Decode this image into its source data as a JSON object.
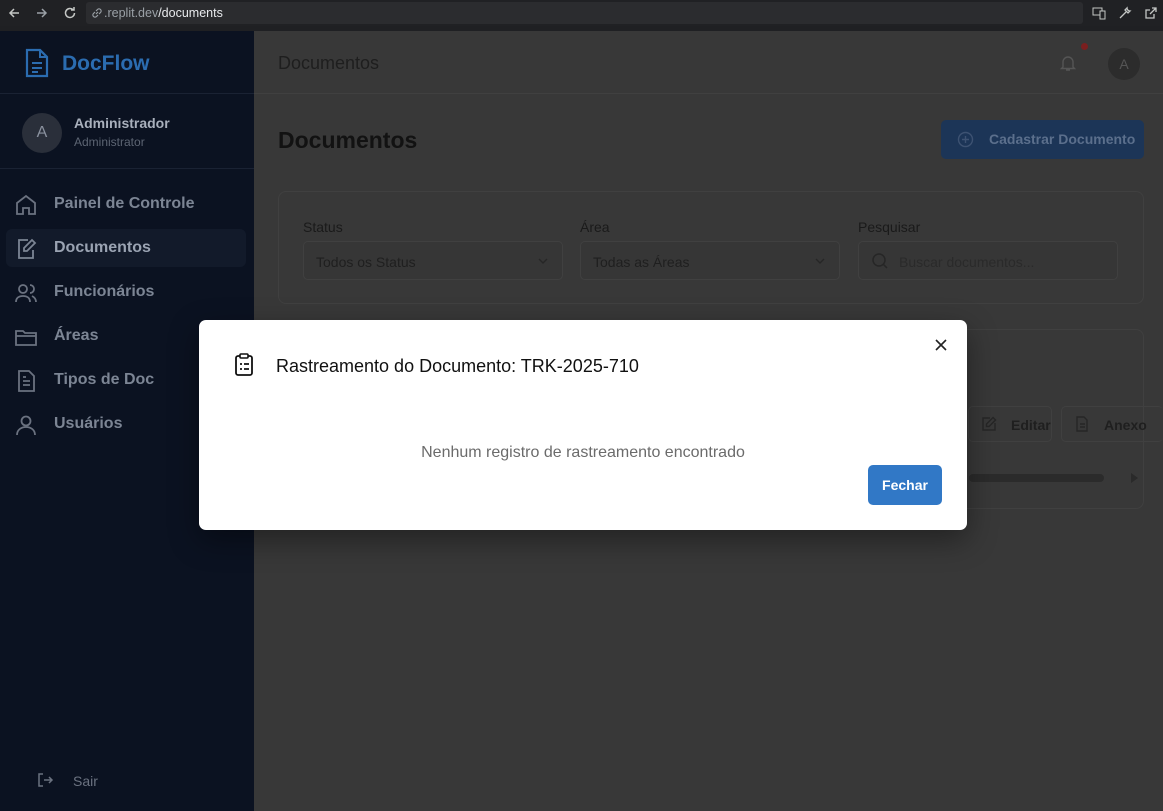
{
  "browser": {
    "url_host": ".replit.dev",
    "url_path": "/documents"
  },
  "sidebar": {
    "brand": "DocFlow",
    "user": {
      "initial": "A",
      "name": "Administrador",
      "role": "Administrator"
    },
    "items": [
      {
        "label": "Painel de Controle",
        "icon": "home-icon",
        "active": false
      },
      {
        "label": "Documentos",
        "icon": "document-edit-icon",
        "active": true
      },
      {
        "label": "Funcionários",
        "icon": "users-icon",
        "active": false
      },
      {
        "label": "Áreas",
        "icon": "folder-icon",
        "active": false
      },
      {
        "label": "Tipos de Doc",
        "icon": "file-text-icon",
        "active": false
      },
      {
        "label": "Usuários",
        "icon": "user-icon",
        "active": false
      }
    ],
    "logout": "Sair"
  },
  "header": {
    "title": "Documentos",
    "avatar_initial": "A"
  },
  "main": {
    "page_title": "Documentos",
    "add_button": "Cadastrar Documento",
    "filters": {
      "status_label": "Status",
      "status_value": "Todos os Status",
      "area_label": "Área",
      "area_value": "Todas as Áreas",
      "search_label": "Pesquisar",
      "search_placeholder": "Buscar documentos..."
    },
    "row_actions": {
      "edit": "Editar",
      "attach": "Anexo"
    }
  },
  "modal": {
    "title": "Rastreamento do Documento: TRK-2025-710",
    "empty_message": "Nenhum registro de rastreamento encontrado",
    "close_button": "Fechar"
  },
  "colors": {
    "primary": "#3178c6",
    "sidebar_bg": "#0b1221",
    "overlay": "#383838"
  }
}
